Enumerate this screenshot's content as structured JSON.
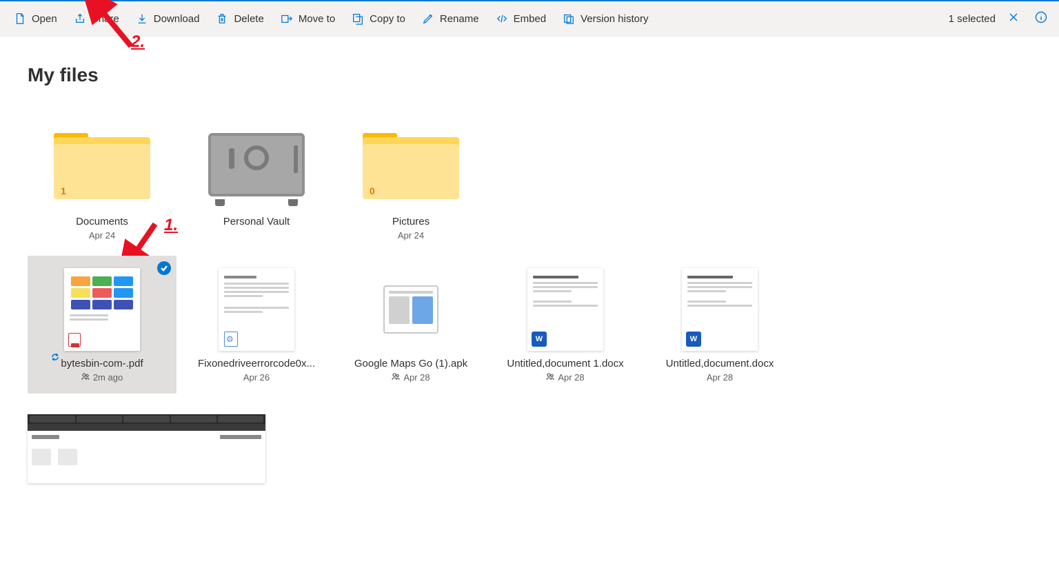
{
  "toolbar": {
    "open": "Open",
    "share": "Share",
    "download": "Download",
    "delete": "Delete",
    "move_to": "Move to",
    "copy_to": "Copy to",
    "rename": "Rename",
    "embed": "Embed",
    "version_history": "Version history"
  },
  "toolbar_right": {
    "selected": "1 selected"
  },
  "page": {
    "title": "My files"
  },
  "annotations": {
    "one": "1.",
    "two": "2."
  },
  "folders": [
    {
      "name": "Documents",
      "date": "Apr 24",
      "badge": "1"
    },
    {
      "name": "Personal Vault",
      "date": "",
      "badge": ""
    },
    {
      "name": "Pictures",
      "date": "Apr 24",
      "badge": "0"
    }
  ],
  "files": [
    {
      "name": "bytesbin-com-.pdf",
      "date": "2m ago",
      "shared": true,
      "selected": true,
      "sync": true,
      "type": "pdf"
    },
    {
      "name": "Fixonedriveerrorcode0x...",
      "date": "Apr 26",
      "shared": false,
      "selected": false,
      "sync": false,
      "type": "txt"
    },
    {
      "name": "Google Maps Go (1).apk",
      "date": "Apr 28",
      "shared": true,
      "selected": false,
      "sync": false,
      "type": "apk"
    },
    {
      "name": "Untitled,document 1.docx",
      "date": "Apr 28",
      "shared": true,
      "selected": false,
      "sync": false,
      "type": "docx"
    },
    {
      "name": "Untitled,document.docx",
      "date": "Apr 28",
      "shared": false,
      "selected": false,
      "sync": false,
      "type": "docx"
    }
  ]
}
